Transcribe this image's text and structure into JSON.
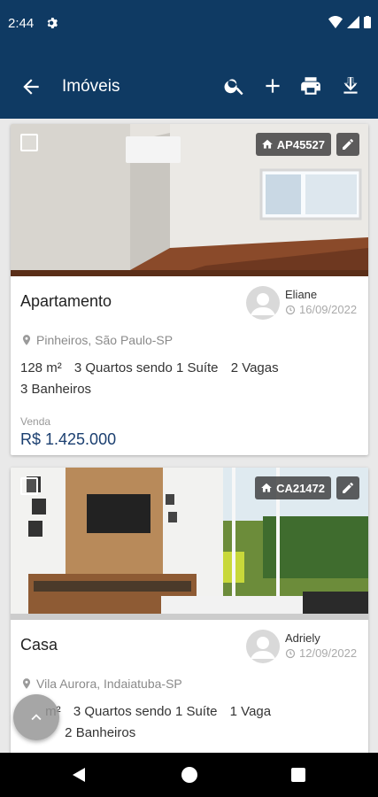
{
  "status_bar": {
    "time": "2:44"
  },
  "app_bar": {
    "title": "Imóveis"
  },
  "listings": [
    {
      "code": "AP45527",
      "title": "Apartamento",
      "agent_name": "Eliane",
      "agent_date": "16/09/2022",
      "location": "Pinheiros, São Paulo-SP",
      "area_num": "128",
      "area_unit": "m²",
      "rooms_num": "3",
      "rooms_text": "Quartos sendo",
      "suites_num": "1",
      "suites_text": "Suíte",
      "parking_num": "2",
      "parking_text": "Vagas",
      "bath_num": "3",
      "bath_text": "Banheiros",
      "price_label": "Venda",
      "price": "R$ 1.425.000"
    },
    {
      "code": "CA21472",
      "title": "Casa",
      "agent_name": "Adriely",
      "agent_date": "12/09/2022",
      "location": "Vila Aurora, Indaiatuba-SP",
      "area_unit": "m²",
      "rooms_num": "3",
      "rooms_text": "Quartos sendo",
      "suites_num": "1",
      "suites_text": "Suíte",
      "parking_num": "1",
      "parking_text": "Vaga",
      "bath_num": "2",
      "bath_text": "Banheiros"
    }
  ]
}
